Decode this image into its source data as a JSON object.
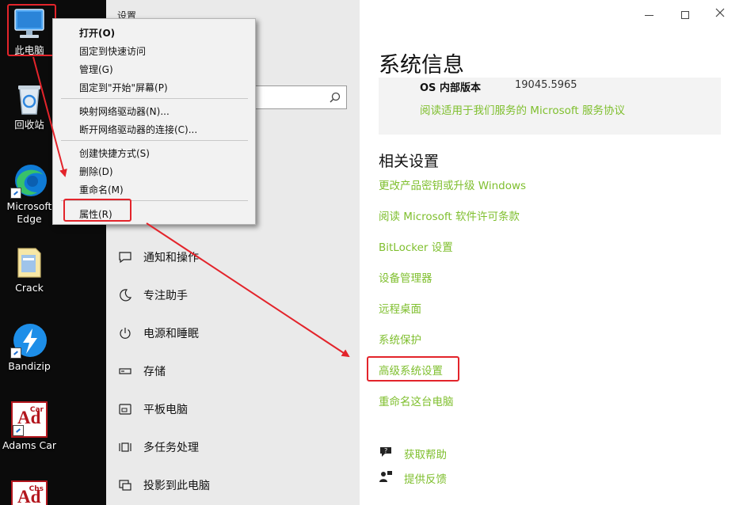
{
  "desktop": {
    "icons": [
      {
        "label": "此电脑",
        "icon": "computer-icon"
      },
      {
        "label": "回收站",
        "icon": "recycle-bin-icon"
      },
      {
        "label": "Microsoft Edge",
        "line1": "Microsoft",
        "line2": "Edge",
        "icon": "edge-icon"
      },
      {
        "label": "Crack",
        "icon": "folder-icon"
      },
      {
        "label": "Bandizip",
        "icon": "bandizip-icon"
      },
      {
        "label": "Adams Car",
        "badge": "Car",
        "glyph": "Ad",
        "icon": "adams-car-icon"
      },
      {
        "label": "",
        "badge": "Chs",
        "glyph": "Ad",
        "icon": "adams-chs-icon"
      }
    ]
  },
  "context_menu": {
    "items": [
      {
        "label": "打开(O)",
        "bold": true
      },
      {
        "label": "固定到快速访问"
      },
      {
        "label": "管理(G)"
      },
      {
        "label": "固定到\"开始\"屏幕(P)"
      },
      {
        "label": "映射网络驱动器(N)..."
      },
      {
        "label": "断开网络驱动器的连接(C)..."
      },
      {
        "label": "创建快捷方式(S)"
      },
      {
        "label": "删除(D)"
      },
      {
        "label": "重命名(M)"
      },
      {
        "label": "属性(R)",
        "highlighted": true
      }
    ]
  },
  "settings": {
    "window_title": "设置",
    "search_icon": "search-icon",
    "nav_items": [
      {
        "label": "通知和操作",
        "icon": "notification-icon"
      },
      {
        "label": "专注助手",
        "icon": "moon-icon"
      },
      {
        "label": "电源和睡眠",
        "icon": "power-icon"
      },
      {
        "label": "存储",
        "icon": "storage-icon"
      },
      {
        "label": "平板电脑",
        "icon": "tablet-icon"
      },
      {
        "label": "多任务处理",
        "icon": "multitask-icon"
      },
      {
        "label": "投影到此电脑",
        "icon": "project-icon"
      }
    ],
    "content": {
      "page_title": "系统信息",
      "os_build_label": "OS 内部版本",
      "os_build_value": "19045.5965",
      "agreement_link": "阅读适用于我们服务的 Microsoft 服务协议",
      "related_title": "相关设置",
      "related_links": [
        "更改产品密钥或升级 Windows",
        "阅读 Microsoft 软件许可条款",
        "BitLocker 设置",
        "设备管理器",
        "远程桌面",
        "系统保护",
        "高级系统设置",
        "重命名这台电脑"
      ],
      "help_link": "获取帮助",
      "feedback_link": "提供反馈"
    },
    "window_controls": {
      "minimize": "—",
      "maximize": "☐",
      "close": "✕"
    }
  },
  "colors": {
    "link": "#7fbf2e",
    "annotation_red": "#e3242b",
    "left_pane": "#eaeaea"
  }
}
